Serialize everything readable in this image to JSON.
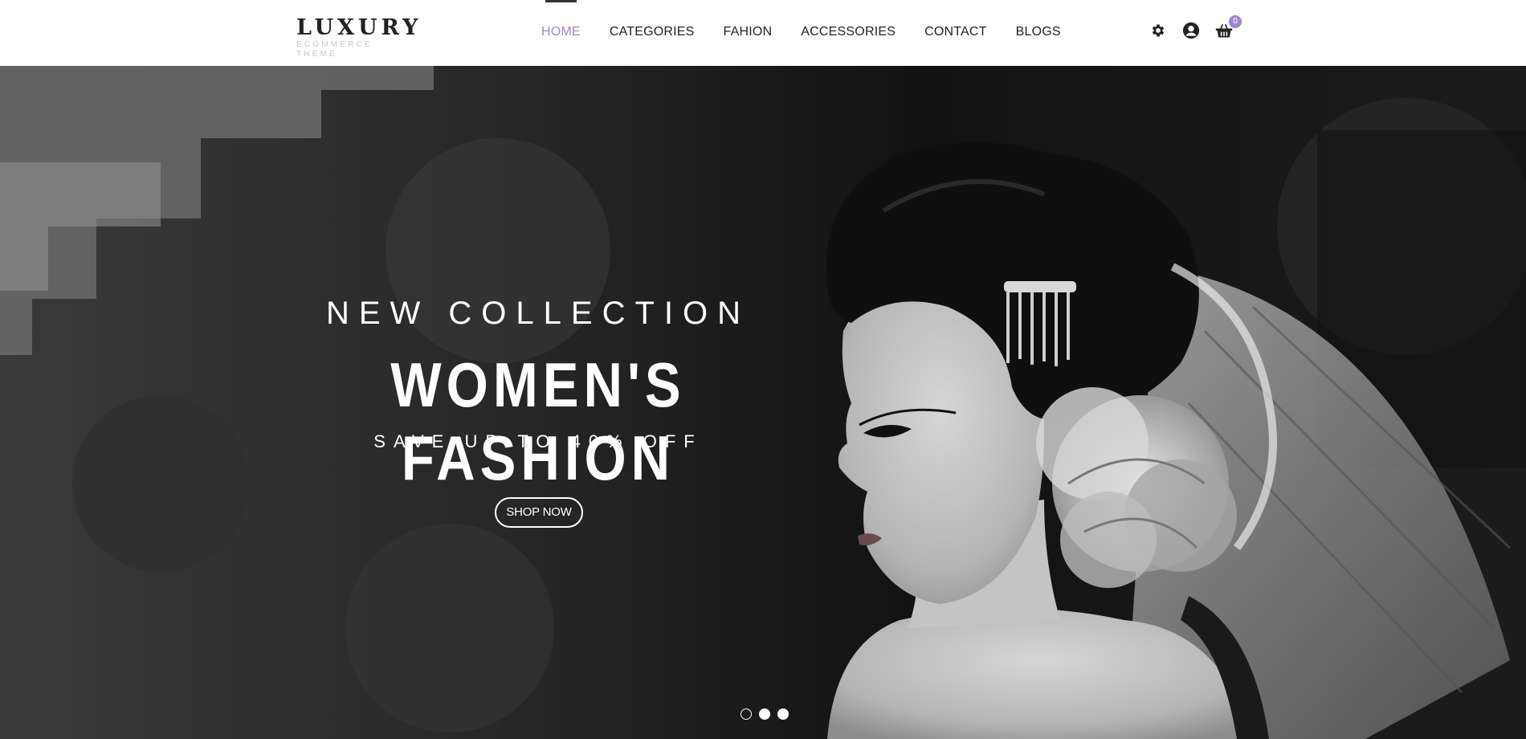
{
  "brand": {
    "title": "LUXURY",
    "subtitle": "ECOMMERCE THEME"
  },
  "nav": {
    "items": [
      {
        "label": "HOME",
        "active": true
      },
      {
        "label": "CATEGORIES",
        "active": false
      },
      {
        "label": "FAHION",
        "active": false
      },
      {
        "label": "ACCESSORIES",
        "active": false
      },
      {
        "label": "CONTACT",
        "active": false
      },
      {
        "label": "BLOGS",
        "active": false
      }
    ]
  },
  "tools": {
    "settings_icon": "gear-icon",
    "account_icon": "user-circle-icon",
    "cart_icon": "basket-icon",
    "cart_count": "0"
  },
  "hero": {
    "eyebrow": "NEW COLLECTION",
    "headline": "WOMEN'S FASHION",
    "subheadline": "SAVE UP TO 40% OFF",
    "cta_label": "SHOP NOW",
    "slides": [
      {
        "active": false
      },
      {
        "active": true
      },
      {
        "active": true
      }
    ]
  },
  "colors": {
    "accent": "#a286c9",
    "text_dark": "#222222",
    "hero_text": "#ffffff"
  }
}
